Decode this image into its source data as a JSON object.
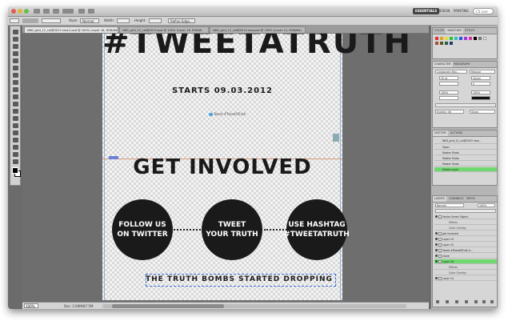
{
  "app": {
    "workspace_buttons": [
      "ESSENTIALS",
      "DESIGN",
      "PAINTING"
    ],
    "search_placeholder": "CS Live"
  },
  "options_bar": {
    "items": [
      "Style:",
      "Normal",
      "Width:",
      "Height:",
      "Refine Edge..."
    ]
  },
  "document_tabs": [
    "NKD_grid_12_col@2015 new.2.psd @ 100% (Layer 16, RGB/8#)",
    "NKD_grid_12_col@2015.psd @ 100% (Layer 16, RGB/8)",
    "NKD_grid_12_col@2015.new.psd @ 100% (Layer 12, RGB/8#)"
  ],
  "canvas": {
    "headline": "#TWEETATRUTH",
    "starts": "STARTS 09.03.2012",
    "tweet_button": "Tweet #TweetATruth",
    "get_involved": "GET INVOLVED",
    "circles": [
      {
        "line1": "FOLLOW US",
        "line2": "ON TWITTER"
      },
      {
        "line1": "TWEET",
        "line2": "YOUR TRUTH"
      },
      {
        "line1": "USE HASHTAG",
        "line2": "#TWEETATRUTH"
      }
    ],
    "bombs": "THE TRUTH BOMBS STARTED DROPPING"
  },
  "status": {
    "zoom": "100%",
    "doc_info": "Doc: 2.66M/87.5M"
  },
  "panels": {
    "color_tabs": [
      "COLOR",
      "SWATCHES",
      "STYLES"
    ],
    "character_tabs": [
      "CHARACTER",
      "PARAGRAPH"
    ],
    "font_family": "Colaborate-Reg...",
    "font_style": "Regular",
    "font_size": "20 pt",
    "leading": "(Auto)",
    "tracking": "0",
    "scale_v": "100%",
    "scale_h": "100%",
    "language": "English: UK",
    "antialias": "Sharp",
    "history_tabs": [
      "HISTORY",
      "ACTIONS"
    ],
    "history_items": [
      "NKD_grid_12_col@2015 new...",
      "Open",
      "Master Shots",
      "Master Shots",
      "Master Shots",
      "Delete Layer"
    ],
    "layers_tabs": [
      "LAYERS",
      "CHANNELS",
      "PATHS"
    ],
    "blend_mode": "Normal",
    "opacity": "100%",
    "layer_items": [
      {
        "name": "Vector Smart Object",
        "kind": "layer"
      },
      {
        "name": "Effects",
        "kind": "fx"
      },
      {
        "name": "Color Overlay",
        "kind": "fx"
      },
      {
        "name": "get involved",
        "kind": "layer"
      },
      {
        "name": "Layer 19",
        "kind": "layer"
      },
      {
        "name": "Layer 15",
        "kind": "layer"
      },
      {
        "name": "Tweet #TweetATruth b...",
        "kind": "layer"
      },
      {
        "name": "share",
        "kind": "layer"
      },
      {
        "name": "Layer 18",
        "kind": "layer"
      },
      {
        "name": "Effects",
        "kind": "fx"
      },
      {
        "name": "Color Overlay",
        "kind": "fx"
      },
      {
        "name": "Layer 14",
        "kind": "layer"
      }
    ]
  },
  "colors": {
    "accent_green": "#6fd86f",
    "canvas_ink": "#1a1a1a"
  }
}
